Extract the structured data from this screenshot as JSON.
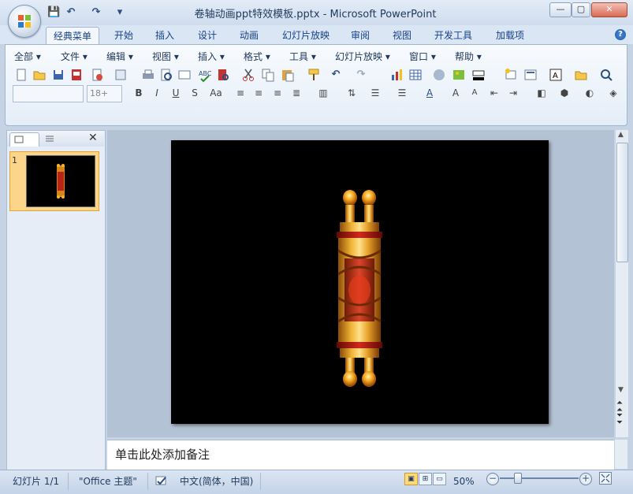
{
  "window": {
    "title": "卷轴动画ppt特效模板.pptx - Microsoft PowerPoint",
    "controls": [
      "—",
      "▢",
      "✕"
    ]
  },
  "quick_access": {
    "save": "💾",
    "undo": "↶",
    "redo": "↷",
    "customize": "▾"
  },
  "tabs": [
    "经典菜单",
    "开始",
    "插入",
    "设计",
    "动画",
    "幻灯片放映",
    "审阅",
    "视图",
    "开发工具",
    "加载项"
  ],
  "active_tab": "经典菜单",
  "help": "?",
  "classic_menu": [
    "全部 ▾",
    "文件 ▾",
    "编辑 ▾",
    "视图 ▾",
    "插入 ▾",
    "格式 ▾",
    "工具 ▾",
    "幻灯片放映 ▾",
    "窗口 ▾",
    "帮助 ▾"
  ],
  "font_size_combo": "18+",
  "slides_panel": {
    "slide_number": "1",
    "close": "✕"
  },
  "notes": {
    "placeholder": "单击此处添加备注"
  },
  "status_bar": {
    "slide_info": "幻灯片 1/1",
    "theme": "\"Office 主题\"",
    "language": "中文(简体，中国)",
    "zoom": "50%",
    "zoom_minus": "−",
    "zoom_plus": "+"
  },
  "colors": {
    "accent": "#15428b",
    "slide_background": "#000000",
    "thumb_selected": "#fcd48a"
  }
}
